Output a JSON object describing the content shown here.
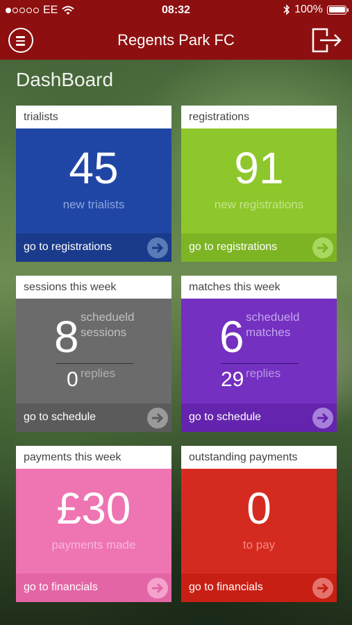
{
  "status_bar": {
    "carrier": "EE",
    "time": "08:32",
    "battery": "100%"
  },
  "header": {
    "title": "Regents Park FC",
    "menu_icon": "hamburger-circle-icon",
    "logout_icon": "logout-icon"
  },
  "page": {
    "title": "DashBoard"
  },
  "cards": {
    "trialists": {
      "header": "trialists",
      "value": "45",
      "label": "new trialists",
      "link": "go to registrations",
      "color": "#2046a5",
      "footer_color": "#1a3a8b"
    },
    "registrations": {
      "header": "registrations",
      "value": "91",
      "label": "new registrations",
      "link": "go to registrations",
      "color": "#8ec72b",
      "footer_color": "#7db424"
    },
    "sessions": {
      "header": "sessions this week",
      "value": "8",
      "label": "schedueld sessions",
      "replies_value": "0",
      "replies_label": "replies",
      "link": "go to schedule",
      "color": "#6b6b6b",
      "footer_color": "#5b5b5b"
    },
    "matches": {
      "header": "matches this week",
      "value": "6",
      "label": "schedueld matches",
      "replies_value": "29",
      "replies_label": "replies",
      "link": "go to schedule",
      "color": "#7430c0",
      "footer_color": "#6424ad"
    },
    "payments": {
      "header": "payments this week",
      "value": "£30",
      "label": "payments made",
      "link": "go to financials",
      "color": "#ee74b2",
      "footer_color": "#e465a5"
    },
    "outstanding": {
      "header": "outstanding payments",
      "value": "0",
      "label": "to pay",
      "link": "go to financials",
      "color": "#d52a1f",
      "footer_color": "#c81f14"
    }
  }
}
